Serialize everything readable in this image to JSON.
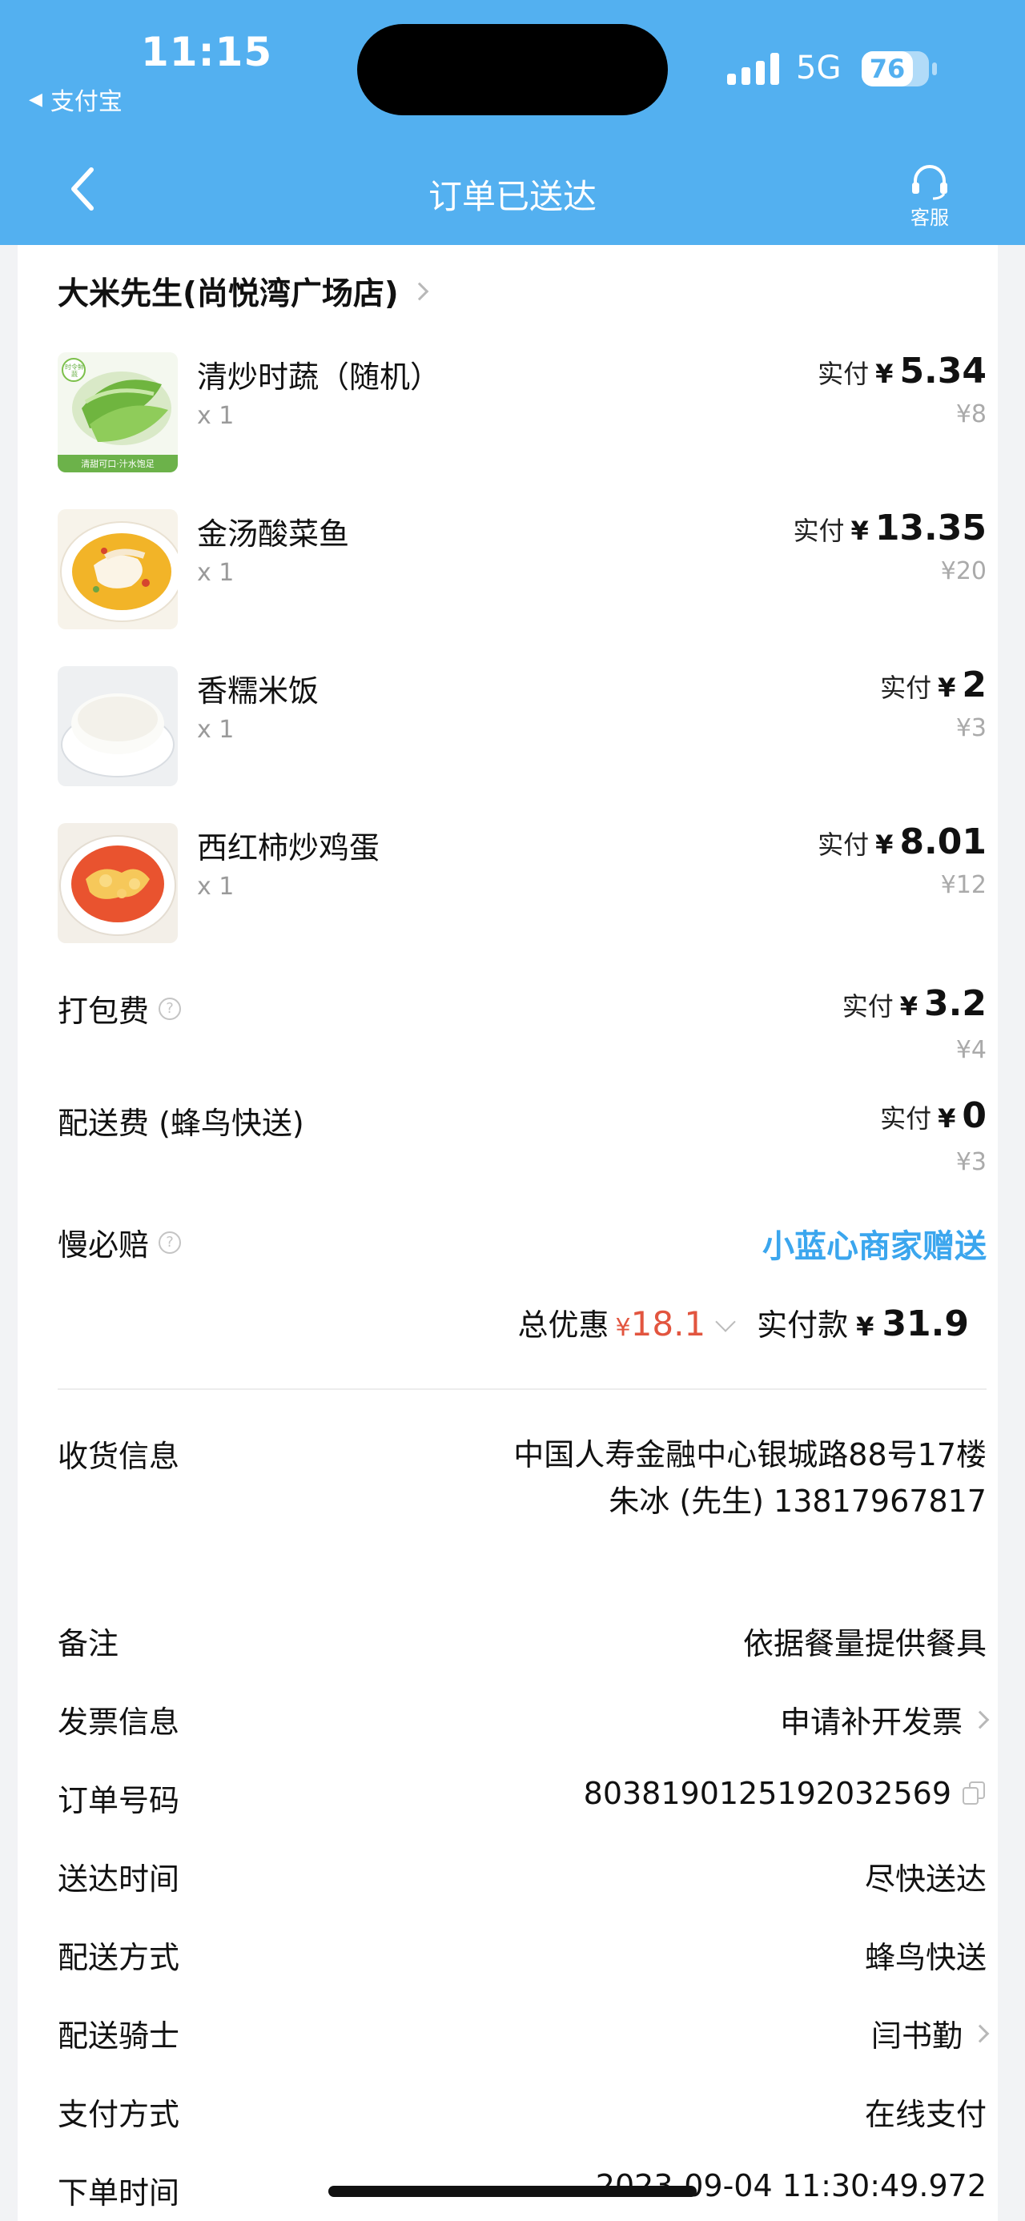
{
  "status_bar": {
    "time": "11:15",
    "back_app": "支付宝",
    "network": "5G",
    "battery": "76",
    "battery_level": 0.76
  },
  "nav": {
    "title": "订单已送达",
    "service_label": "客服"
  },
  "shop": {
    "name": "大米先生(尚悦湾广场店)"
  },
  "items": [
    {
      "name": "清炒时蔬（随机）",
      "qty": "x 1",
      "paid_label": "实付",
      "currency": "¥",
      "paid": "5.34",
      "original": "¥8"
    },
    {
      "name": "金汤酸菜鱼",
      "qty": "x 1",
      "paid_label": "实付",
      "currency": "¥",
      "paid": "13.35",
      "original": "¥20"
    },
    {
      "name": "香糯米饭",
      "qty": "x 1",
      "paid_label": "实付",
      "currency": "¥",
      "paid": "2",
      "original": "¥3"
    },
    {
      "name": "西红柿炒鸡蛋",
      "qty": "x 1",
      "paid_label": "实付",
      "currency": "¥",
      "paid": "8.01",
      "original": "¥12"
    }
  ],
  "item_image_caption": "清甜可口·汁水饱足",
  "item_image_badge": "时令鲜蔬",
  "fees": {
    "packing": {
      "label": "打包费",
      "paid_label": "实付",
      "currency": "¥",
      "paid": "3.2",
      "original": "¥4"
    },
    "delivery": {
      "label": "配送费 (蜂鸟快送)",
      "paid_label": "实付",
      "currency": "¥",
      "paid": "0",
      "original": "¥3"
    },
    "late_comp": {
      "label": "慢必赔",
      "value": "小蓝心商家赠送"
    }
  },
  "totals": {
    "discount_label": "总优惠",
    "discount_currency": "¥",
    "discount": "18.1",
    "paid_label": "实付款",
    "paid_currency": "¥",
    "paid": "31.9"
  },
  "info": {
    "receiver": {
      "label": "收货信息",
      "address": "中国人寿金融中心银城路88号17楼",
      "contact": "朱冰 (先生) 13817967817"
    },
    "note": {
      "label": "备注",
      "value": "依据餐量提供餐具"
    },
    "invoice": {
      "label": "发票信息",
      "value": "申请补开发票"
    },
    "order_no": {
      "label": "订单号码",
      "value": "8038190125192032569"
    },
    "delivery_time": {
      "label": "送达时间",
      "value": "尽快送达"
    },
    "delivery_method": {
      "label": "配送方式",
      "value": "蜂鸟快送"
    },
    "rider": {
      "label": "配送骑士",
      "value": "闫书勤"
    },
    "payment": {
      "label": "支付方式",
      "value": "在线支付"
    },
    "order_time": {
      "label": "下单时间",
      "value": "2023-09-04 11:30:49.972"
    }
  },
  "colors": {
    "header": "#53b0f0",
    "accent_blue": "#3ba6ee",
    "discount_red": "#e2553f"
  }
}
